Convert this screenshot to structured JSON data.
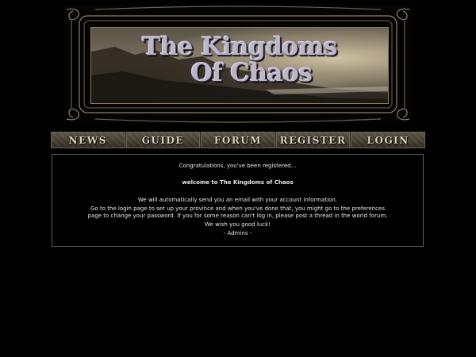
{
  "banner": {
    "title_line1": "The Kingdoms",
    "title_line2": "Of Chaos"
  },
  "nav": {
    "items": [
      {
        "label": "NEWS"
      },
      {
        "label": "GUIDE"
      },
      {
        "label": "FORUM"
      },
      {
        "label": "REGISTER"
      },
      {
        "label": "LOGIN"
      }
    ]
  },
  "content": {
    "congrats": "Congratulations, you've been registered...",
    "welcome": "welcome to The Kingdoms of Chaos",
    "email": "We will automatically send you an email with your account information.",
    "instructions": "Go to the login page to set up your province and when you've done that, you might go to the preferences page to change your password. If you for some reason can't log in, please post a thread in the world forum.",
    "luck": "We wish you good luck!",
    "signature": "- Admins -"
  },
  "colors": {
    "background": "#000000",
    "text": "#e8e8e8",
    "content_border": "#5e5e5e",
    "nav_text": "#d8d2c0"
  }
}
